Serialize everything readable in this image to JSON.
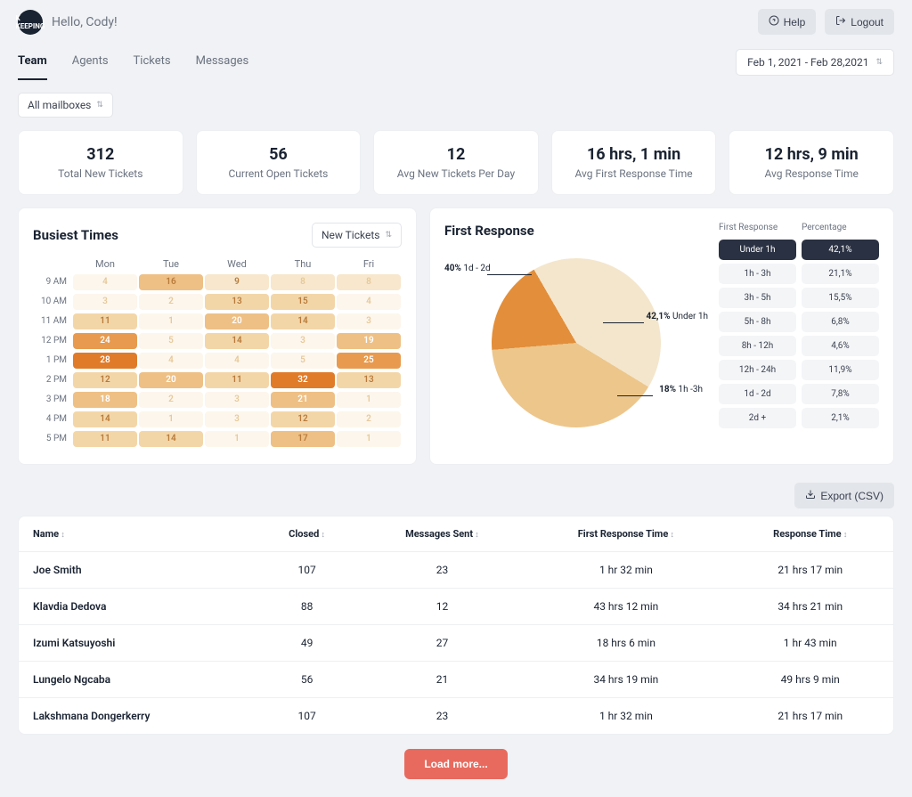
{
  "header": {
    "greeting": "Hello, Cody!",
    "help_label": "Help",
    "logout_label": "Logout"
  },
  "tabs": {
    "items": [
      "Team",
      "Agents",
      "Tickets",
      "Messages"
    ],
    "active": "Team",
    "date_range": "Feb 1, 2021 - Feb 28,2021"
  },
  "filters": {
    "mailbox_label": "All mailboxes"
  },
  "stats": [
    {
      "value": "312",
      "label": "Total New Tickets"
    },
    {
      "value": "56",
      "label": "Current Open Tickets"
    },
    {
      "value": "12",
      "label": "Avg New Tickets Per Day"
    },
    {
      "value": "16 hrs, 1 min",
      "label": "Avg First Response Time"
    },
    {
      "value": "12 hrs, 9 min",
      "label": "Avg Response Time"
    }
  ],
  "busiest": {
    "title": "Busiest Times",
    "dropdown": "New Tickets",
    "days": [
      "Mon",
      "Tue",
      "Wed",
      "Thu",
      "Fri"
    ],
    "hours": [
      "9 AM",
      "10 AM",
      "11 AM",
      "12 PM",
      "1 PM",
      "2 PM",
      "3 PM",
      "4 PM",
      "5 PM"
    ]
  },
  "first_response": {
    "title": "First Response",
    "col1_header": "First Response",
    "col2_header": "Percentage",
    "rows": [
      {
        "range": "Under 1h",
        "pct": "42,1%"
      },
      {
        "range": "1h - 3h",
        "pct": "21,1%"
      },
      {
        "range": "3h - 5h",
        "pct": "15,5%"
      },
      {
        "range": "5h - 8h",
        "pct": "6,8%"
      },
      {
        "range": "8h - 12h",
        "pct": "4,6%"
      },
      {
        "range": "12h - 24h",
        "pct": "11,9%"
      },
      {
        "range": "1d - 2d",
        "pct": "7,8%"
      },
      {
        "range": "2d +",
        "pct": "2,1%"
      }
    ],
    "pie_labels": {
      "a": {
        "pct": "40%",
        "txt": "1d - 2d"
      },
      "b": {
        "pct": "42,1%",
        "txt": "Under 1h"
      },
      "c": {
        "pct": "18%",
        "txt": "1h -3h"
      }
    }
  },
  "export_label": "Export (CSV)",
  "agents_table": {
    "columns": [
      "Name",
      "Closed",
      "Messages Sent",
      "First Response Time",
      "Response Time"
    ],
    "rows": [
      {
        "name": "Joe Smith",
        "closed": "107",
        "sent": "23",
        "frt": "1 hr 32 min",
        "rt": "21 hrs 17 min"
      },
      {
        "name": "Klavdia Dedova",
        "closed": "88",
        "sent": "12",
        "frt": "43 hrs 12 min",
        "rt": "34 hrs 21 min"
      },
      {
        "name": "Izumi Katsuyoshi",
        "closed": "49",
        "sent": "27",
        "frt": "18 hrs 6 min",
        "rt": "1 hr 43 min"
      },
      {
        "name": "Lungelo Ngcaba",
        "closed": "56",
        "sent": "21",
        "frt": "34 hrs 19 min",
        "rt": "49 hrs 9 min"
      },
      {
        "name": "Lakshmana Dongerkerry",
        "closed": "107",
        "sent": "23",
        "frt": "1 hr 32 min",
        "rt": "21 hrs 17 min"
      }
    ]
  },
  "load_more": "Load more...",
  "chart_data": [
    {
      "type": "heatmap",
      "title": "Busiest Times",
      "x_categories": [
        "Mon",
        "Tue",
        "Wed",
        "Thu",
        "Fri"
      ],
      "y_categories": [
        "9 AM",
        "10 AM",
        "11 AM",
        "12 PM",
        "1 PM",
        "2 PM",
        "3 PM",
        "4 PM",
        "5 PM"
      ],
      "values": [
        [
          4,
          16,
          9,
          8,
          8
        ],
        [
          3,
          2,
          13,
          15,
          4
        ],
        [
          11,
          1,
          20,
          14,
          3
        ],
        [
          24,
          5,
          14,
          3,
          19
        ],
        [
          28,
          4,
          4,
          5,
          25
        ],
        [
          12,
          20,
          11,
          32,
          13
        ],
        [
          18,
          2,
          3,
          21,
          1
        ],
        [
          14,
          1,
          3,
          12,
          2
        ],
        [
          11,
          14,
          1,
          17,
          1
        ]
      ]
    },
    {
      "type": "pie",
      "title": "First Response",
      "series": [
        {
          "name": "Under 1h",
          "value": 42.1
        },
        {
          "name": "1d - 2d",
          "value": 40
        },
        {
          "name": "1h - 3h",
          "value": 18
        }
      ]
    }
  ],
  "colors": {
    "heat_scale": [
      "#fdf6ec",
      "#f8e7cc",
      "#f3d6a8",
      "#eec085",
      "#e89a4e",
      "#e07b2a"
    ],
    "pie": [
      "#f4e6cc",
      "#edc68b",
      "#e38e3a"
    ],
    "accent_dark": "#2a3142"
  }
}
